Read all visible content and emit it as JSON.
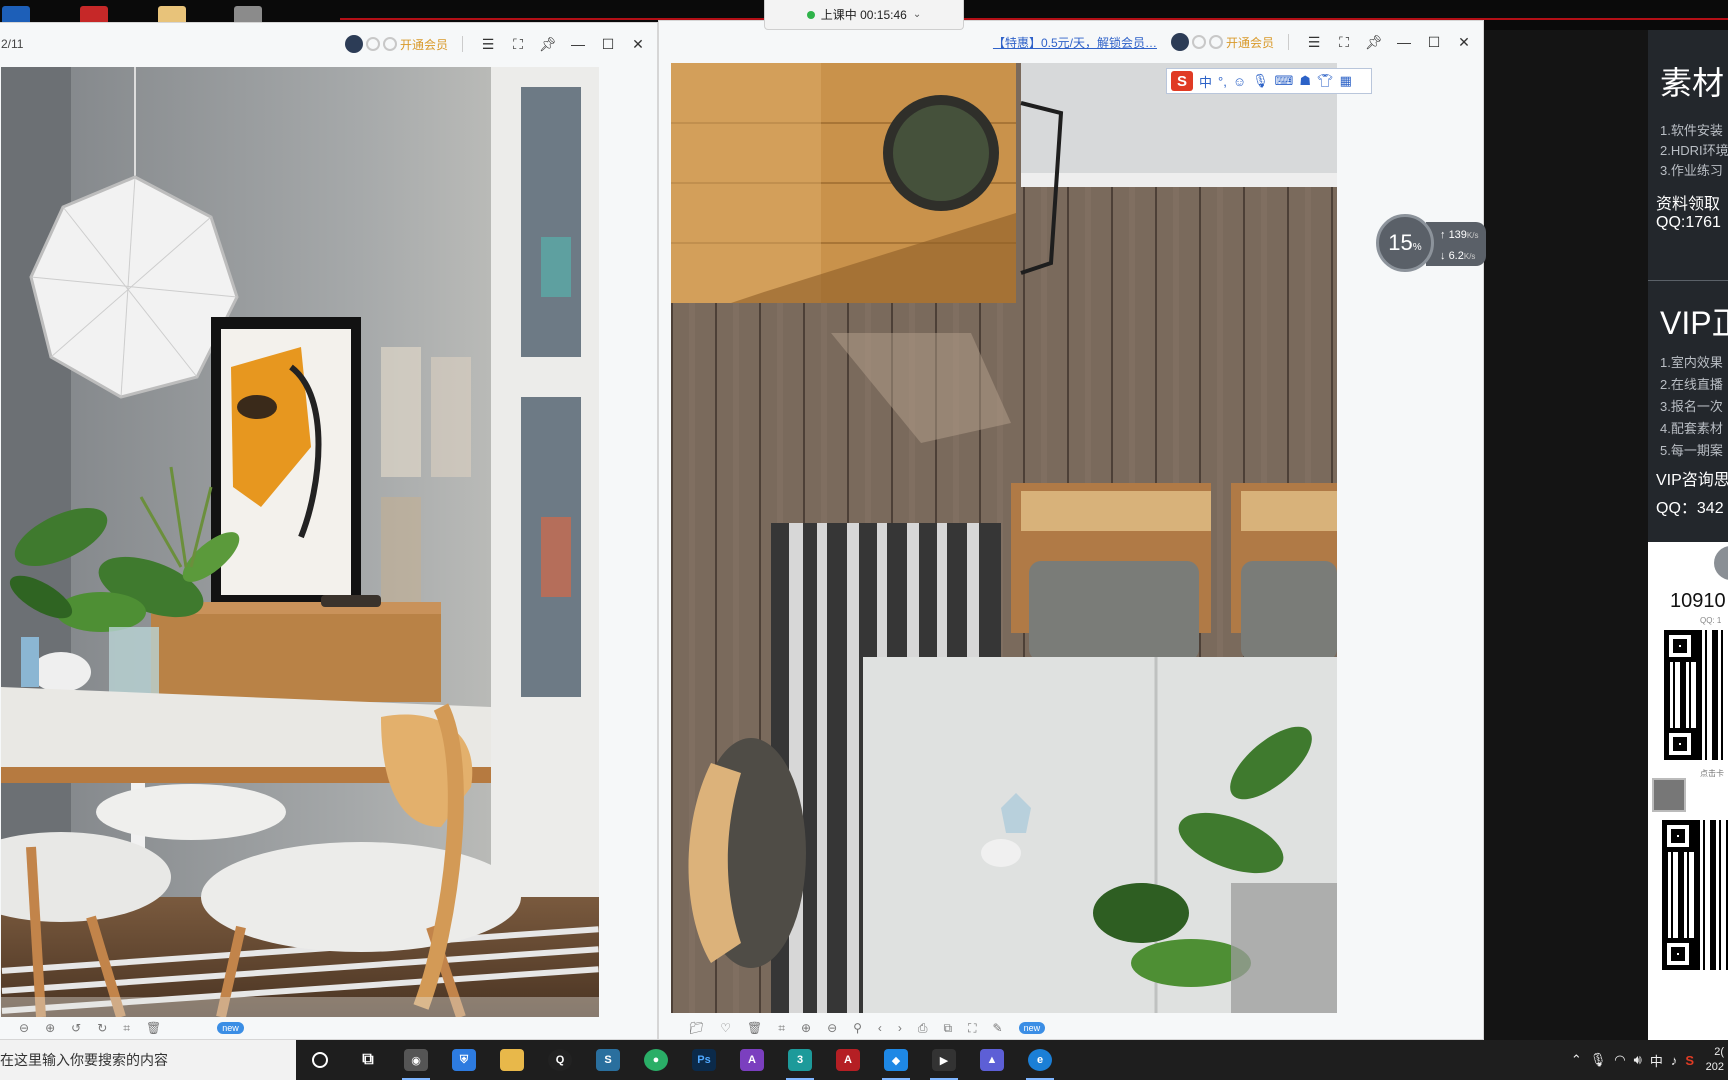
{
  "recording": {
    "label": "上课中 00:15:46"
  },
  "left_window": {
    "page_counter": "2/11",
    "vip_label": "开通会员",
    "new_badge": "new"
  },
  "right_window": {
    "promo_link": "【特惠】0.5元/天，解锁会员…",
    "vip_label": "开通会员",
    "new_badge": "new"
  },
  "ime": {
    "mode": "中",
    "punct": "°,"
  },
  "speed_widget": {
    "percent": "15",
    "percent_unit": "%",
    "upload": "139",
    "upload_unit": "K/s",
    "download": "6.2",
    "download_unit": "K/s"
  },
  "right_panel": {
    "section1_title": "素材",
    "section1_items": [
      "1.软件安装",
      "2.HDRI环境",
      "3.作业练习"
    ],
    "section1_contact_1": "资料领取",
    "section1_contact_2": "QQ:1761",
    "section2_title": "VIP正",
    "section2_items": [
      "1.室内效果",
      "2.在线直播",
      "3.报名一次",
      "4.配套素材",
      "5.每一期案"
    ],
    "section2_contact_1": "VIP咨询思",
    "section2_contact_2": "QQ：342",
    "card_number": "10910",
    "card_qq": "QQ: 1",
    "card_hint": "点击卡"
  },
  "taskbar": {
    "search_placeholder": "在这里输入你要搜索的内容",
    "clock_line1": "2(",
    "clock_line2": "202",
    "tray_ime": "中",
    "app_icons": [
      "cortana-icon",
      "task-view-icon",
      "camera-app-icon",
      "security-icon",
      "file-explorer-icon",
      "qq-icon",
      "steam-icon",
      "wechat-icon",
      "photoshop-icon",
      "affinity-photo-icon",
      "3dsmax-icon",
      "autocad-icon",
      "vscode-like-icon",
      "zoom-icon",
      "gallery-icon",
      "browser-icon"
    ]
  }
}
